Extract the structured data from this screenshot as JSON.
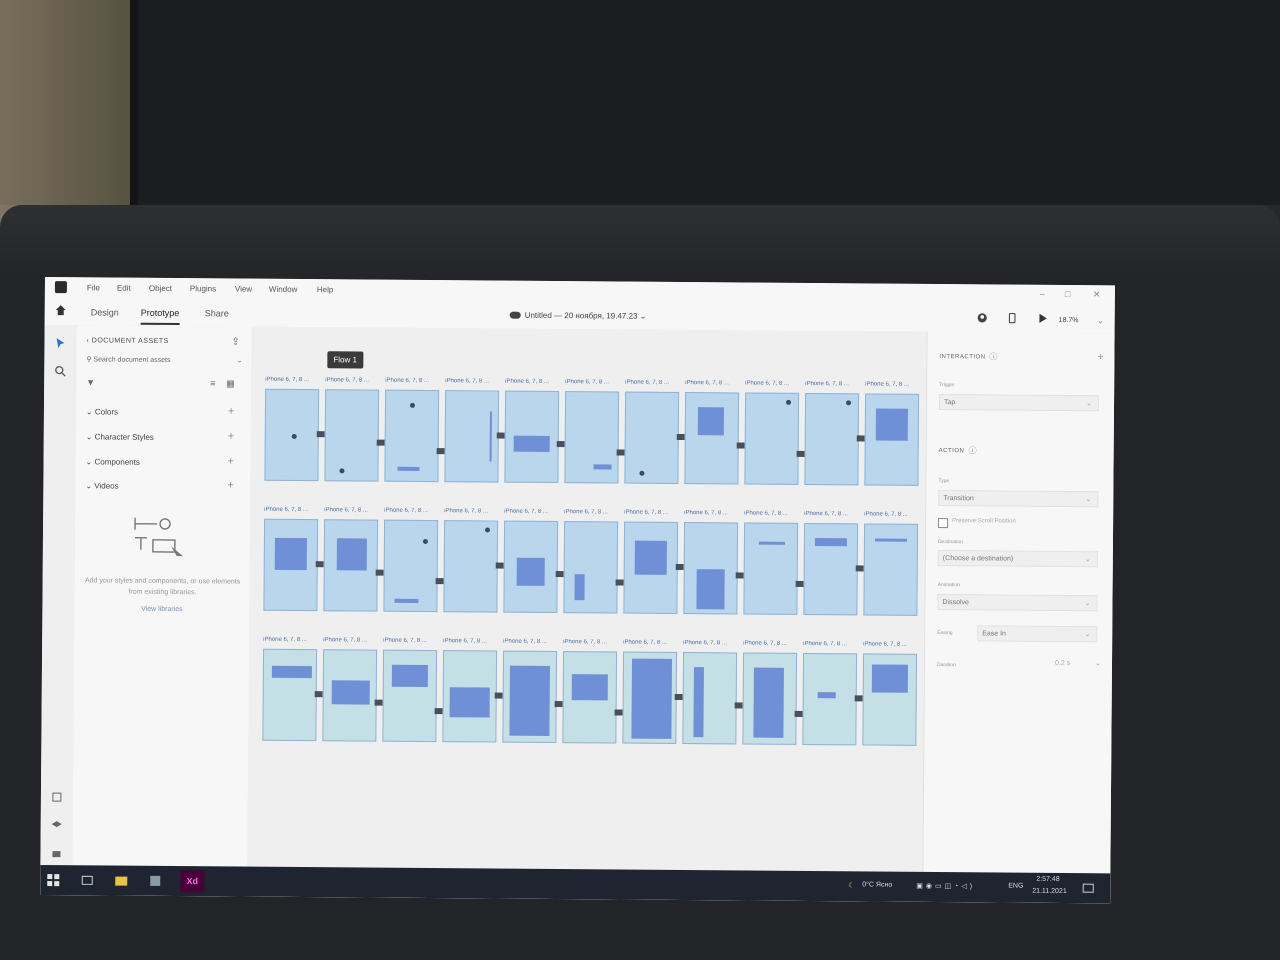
{
  "menu": [
    "File",
    "Edit",
    "Object",
    "Plugins",
    "View",
    "Window",
    "Help"
  ],
  "tabs": {
    "design": "Design",
    "prototype": "Prototype",
    "share": "Share"
  },
  "doc_title": "Untitled — 20 ноября, 19.47.23",
  "zoom": "18.7%",
  "assets": {
    "header": "DOCUMENT ASSETS",
    "search_placeholder": "Search document assets",
    "sections": [
      "Colors",
      "Character Styles",
      "Components",
      "Videos"
    ],
    "empty_text": "Add your styles and components, or use elements from existing libraries.",
    "view_link": "View libraries"
  },
  "flow_label": "Flow 1",
  "artboard_title": "iPhone 6, 7, 8 ...",
  "inspector": {
    "interaction": "INTERACTION",
    "trigger_label": "Trigger",
    "trigger_value": "Tap",
    "action": "ACTION",
    "type_label": "Type",
    "type_value": "Transition",
    "preserve_scroll": "Preserve Scroll Position",
    "destination_label": "Destination",
    "destination_value": "(Choose a destination)",
    "animation_label": "Animation",
    "animation_value": "Dissolve",
    "easing_label": "Easing",
    "easing_value": "Ease In",
    "duration_label": "Duration",
    "duration_value": "0.2 s"
  },
  "taskbar": {
    "weather": "0°C Ясно",
    "lang": "ENG",
    "time": "2:57:48",
    "date": "21.11.2021",
    "xd": "Xd"
  },
  "colors": {
    "artboard": "#b9d6ec",
    "block": "#6f8fd6",
    "taskbar": "#1e2530"
  }
}
